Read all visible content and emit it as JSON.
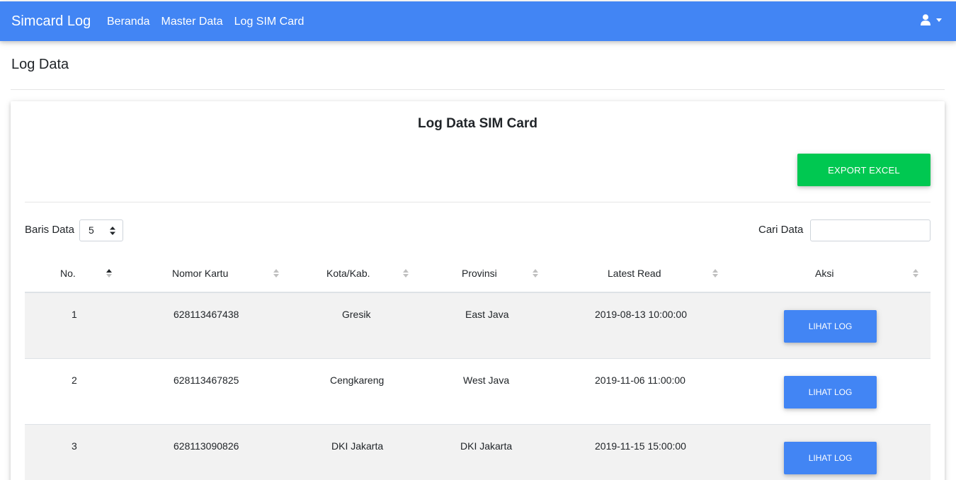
{
  "navbar": {
    "brand": "Simcard Log",
    "links": [
      "Beranda",
      "Master Data",
      "Log SIM Card"
    ],
    "user_icon": "user-icon",
    "color": "#4285f4"
  },
  "page": {
    "title": "Log Data"
  },
  "card": {
    "title": "Log Data SIM Card",
    "export_label": "EXPORT EXCEL",
    "export_color": "#00c851"
  },
  "controls": {
    "rows_label": "Baris Data",
    "rows_value": "5",
    "search_label": "Cari Data",
    "search_value": ""
  },
  "table": {
    "headers": [
      "No.",
      "Nomor Kartu",
      "Kota/Kab.",
      "Provinsi",
      "Latest Read",
      "Aksi"
    ],
    "rows": [
      {
        "no": "1",
        "nomor": "628113467438",
        "kota": "Gresik",
        "provinsi": "East Java",
        "latest": "2019-08-13 10:00:00",
        "aksi": "LIHAT LOG"
      },
      {
        "no": "2",
        "nomor": "628113467825",
        "kota": "Cengkareng",
        "provinsi": "West Java",
        "latest": "2019-11-06 11:00:00",
        "aksi": "LIHAT LOG"
      },
      {
        "no": "3",
        "nomor": "628113090826",
        "kota": "DKI Jakarta",
        "provinsi": "DKI Jakarta",
        "latest": "2019-11-15 15:00:00",
        "aksi": "LIHAT LOG"
      }
    ],
    "button_color": "#4285f4"
  }
}
